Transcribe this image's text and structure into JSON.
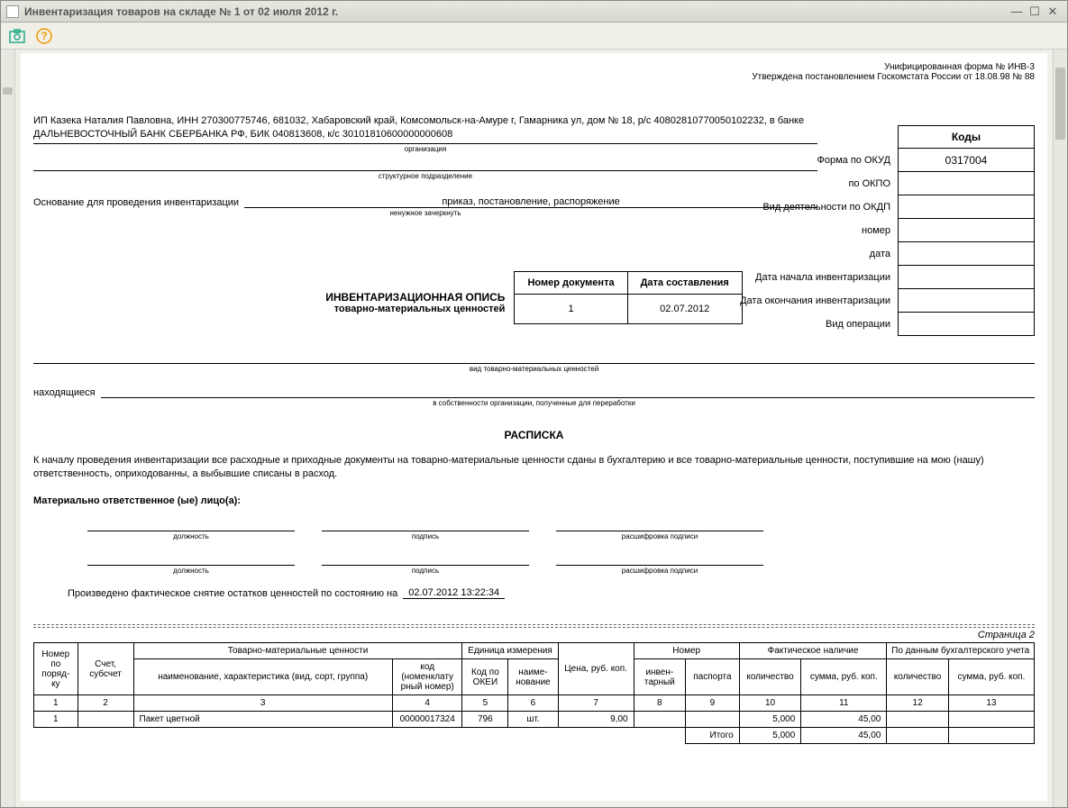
{
  "window": {
    "title": "Инвентаризация товаров на складе № 1 от 02 июля 2012 г."
  },
  "header": {
    "form_line": "Унифицированная форма № ИНВ-3",
    "approved_line": "Утверждена постановлением Госкомстата России от 18.08.98 № 88"
  },
  "codes": {
    "title": "Коды",
    "okud_label": "Форма по ОКУД",
    "okud": "0317004",
    "okpo_label": "по ОКПО",
    "okpo": "",
    "okdp_label": "Вид деятельности по ОКДП",
    "okdp": "",
    "number_label": "номер",
    "number": "",
    "date_label": "дата",
    "date": "",
    "start_label": "Дата начала инвентаризации",
    "start": "",
    "end_label": "Дата окончания инвентаризации",
    "end": "",
    "op_label": "Вид операции",
    "op": ""
  },
  "org": {
    "text": "ИП Казека Наталия Павловна, ИНН 270300775746, 681032, Хабаровский край, Комсомольск-на-Амуре г, Гамарника ул, дом № 18, р/с 40802810770050102232, в банке ДАЛЬНЕВОСТОЧНЫЙ БАНК СБЕРБАНКА РФ, БИК 040813608, к/с 30101810600000000608",
    "caption": "организация",
    "struct_caption": "структурное подразделение"
  },
  "basis": {
    "label": "Основание для проведения инвентаризации",
    "value": "приказ, постановление, распоряжение",
    "caption": "ненужное зачеркнуть"
  },
  "doc": {
    "title_main": "ИНВЕНТАРИЗАЦИОННАЯ ОПИСЬ",
    "title_sub": "товарно-материальных ценностей",
    "num_hdr": "Номер документа",
    "date_hdr": "Дата составления",
    "num": "1",
    "date": "02.07.2012"
  },
  "mid": {
    "type_caption": "вид товарно-материальных ценностей",
    "located_label": "находящиеся",
    "located_caption": "в собственности организации, полученные для переработки"
  },
  "raspiska": {
    "title": "РАСПИСКА",
    "text": "К началу проведения инвентаризации все расходные и приходные документы на товарно-материальные ценности сданы в бухгалтерию и все товарно-материальные ценности, поступившие на мою (нашу) ответственность, оприходованны, а выбывшие списаны в расход."
  },
  "resp": {
    "title": "Материально ответственное (ые) лицо(а):",
    "pos_caption": "должность",
    "sig_caption": "подпись",
    "dec_caption": "расшифровка подписи"
  },
  "snapshot": {
    "label": "Произведено фактическое снятие остатков ценностей по состоянию на",
    "value": "02.07.2012 13:22:34"
  },
  "page2_label": "Страница 2",
  "table": {
    "headers": {
      "num": "Номер по поряд-ку",
      "account": "Счет, субсчет",
      "tmc": "Товарно-материальные ценности",
      "unit": "Единица измерения",
      "price": "Цена, руб. коп.",
      "number_group": "Номер",
      "fact": "Фактическое наличие",
      "book": "По данным бухгалтерского учета",
      "name": "наименование, характеристика (вид, сорт, группа)",
      "code": "код (номенклату рный номер)",
      "okei": "Код по ОКЕИ",
      "unit_name": "наиме-нование",
      "inv_num": "инвен-тарный",
      "passport": "паспорта",
      "qty": "количество",
      "sum": "сумма, руб. коп."
    },
    "colnums": [
      "1",
      "2",
      "3",
      "4",
      "5",
      "6",
      "7",
      "8",
      "9",
      "10",
      "11",
      "12",
      "13"
    ],
    "rows": [
      {
        "n": "1",
        "account": "",
        "name": "Пакет цветной",
        "code": "00000017324",
        "okei": "796",
        "unit": "шт.",
        "price": "9,00",
        "inv": "",
        "pass": "",
        "fact_qty": "5,000",
        "fact_sum": "45,00",
        "book_qty": "",
        "book_sum": ""
      }
    ],
    "total": {
      "label": "Итого",
      "fact_qty": "5,000",
      "fact_sum": "45,00"
    }
  }
}
